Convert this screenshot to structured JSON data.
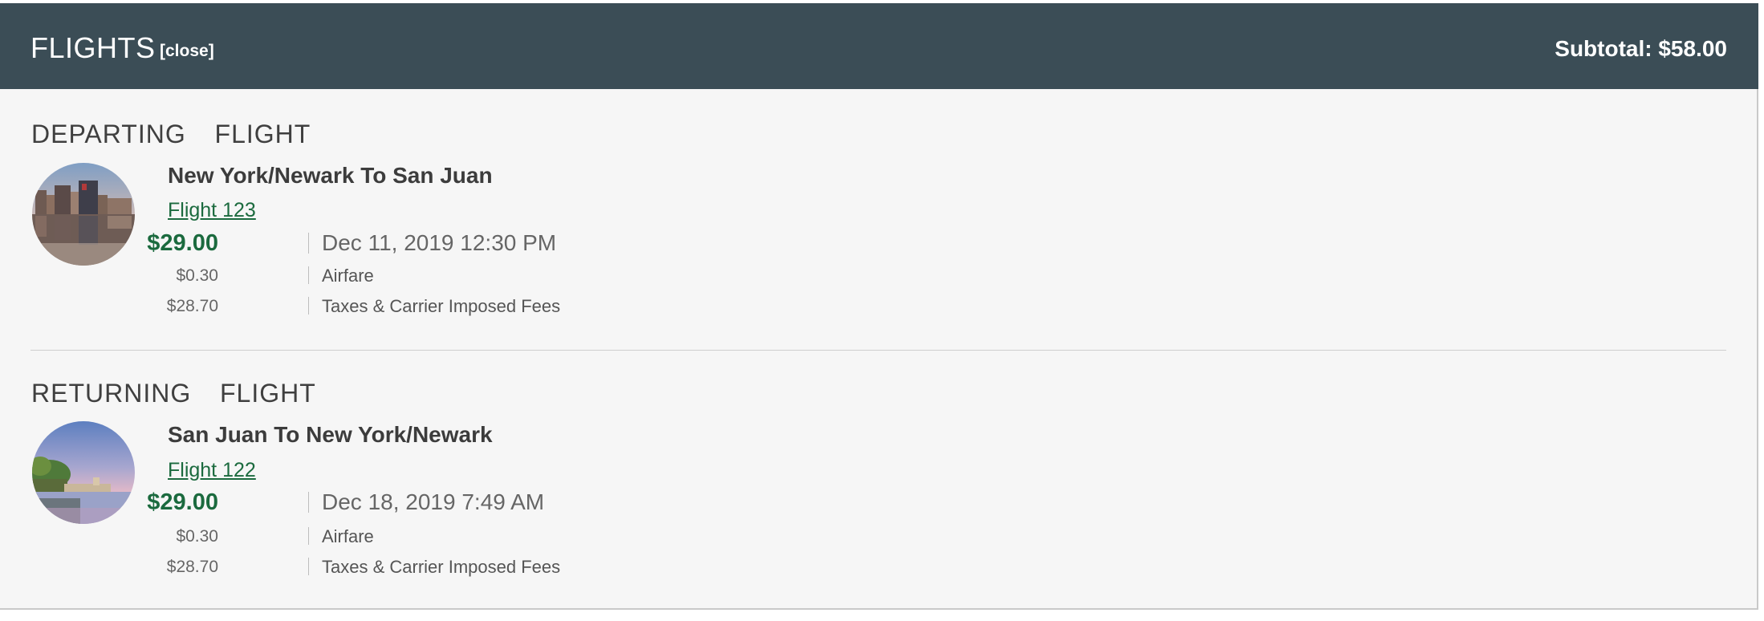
{
  "header": {
    "title": "FLIGHTS",
    "close_label": "[close]",
    "subtotal": "Subtotal: $58.00"
  },
  "departing": {
    "section_title": "DEPARTING  FLIGHT",
    "route": "New York/Newark To San Juan",
    "flight_link": "Flight 123",
    "total": {
      "amount": "$29.00",
      "label": "Dec 11, 2019 12:30 PM"
    },
    "breakdown": [
      {
        "amount": "$0.30",
        "label": "Airfare"
      },
      {
        "amount": "$28.70",
        "label": "Taxes & Carrier Imposed Fees"
      }
    ],
    "image_icon": "city-skyline-photo"
  },
  "returning": {
    "section_title": "RETURNING  FLIGHT",
    "route": "San Juan To New York/Newark",
    "flight_link": "Flight 122",
    "total": {
      "amount": "$29.00",
      "label": "Dec 18, 2019 7:49 AM"
    },
    "breakdown": [
      {
        "amount": "$0.30",
        "label": "Airfare"
      },
      {
        "amount": "$28.70",
        "label": "Taxes & Carrier Imposed Fees"
      }
    ],
    "image_icon": "coastal-fort-photo"
  },
  "colors": {
    "header_bg": "#3b4d56",
    "panel_bg": "#f6f6f6",
    "accent_green": "#1b6a3e"
  }
}
